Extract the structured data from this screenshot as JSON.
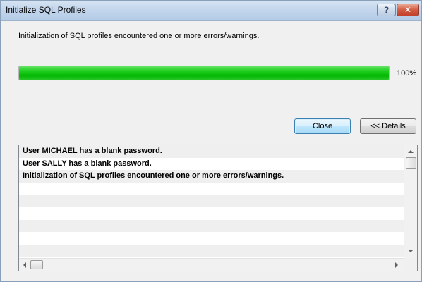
{
  "window": {
    "title": "Initialize SQL Profiles",
    "help_label": "?",
    "close_label": "✕"
  },
  "message": "Initialization of SQL profiles encountered one or more errors/warnings.",
  "progress": {
    "fraction": 1.0,
    "label": "100%",
    "color": "#1fcf1f"
  },
  "buttons": {
    "close_label": "Close",
    "details_label": "<< Details"
  },
  "log": {
    "lines": [
      "User MICHAEL has a blank password.",
      "User SALLY has a blank password.",
      "Initialization of SQL profiles encountered one or more errors/warnings."
    ]
  },
  "icons": {
    "scroll_up": "scroll-up-arrow-icon",
    "scroll_down": "scroll-down-arrow-icon",
    "scroll_left": "scroll-left-arrow-icon",
    "scroll_right": "scroll-right-arrow-icon"
  }
}
